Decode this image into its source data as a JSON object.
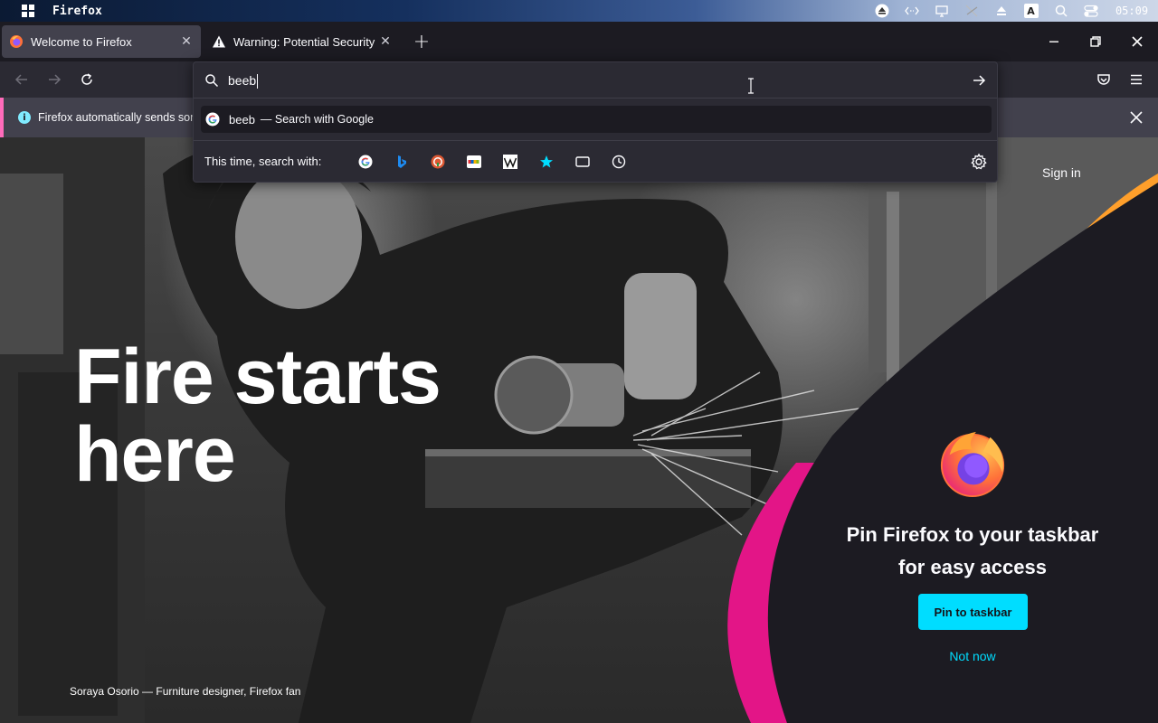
{
  "os_bar": {
    "app_name": "Firefox",
    "clock": "05:09",
    "tray_icons": [
      "eject-icon",
      "network-arrows-icon",
      "display-icon",
      "no-signal-icon",
      "eject-outline-icon",
      "keyboard-layout-icon",
      "search-icon",
      "toggle-icon"
    ],
    "keyboard_letter": "A"
  },
  "tabs": [
    {
      "title": "Welcome to Firefox",
      "icon": "firefox-icon",
      "active": true
    },
    {
      "title": "Warning: Potential Security Risk Ahead",
      "icon": "warning-icon",
      "active": false
    }
  ],
  "urlbar": {
    "value": "beeb",
    "suggestion_query": "beeb",
    "suggestion_action": "— Search with Google",
    "one_off_label": "This time, search with:",
    "engines": [
      "google-icon",
      "bing-icon",
      "duckduckgo-icon",
      "ebay-icon",
      "wikipedia-icon",
      "bookmarks-icon",
      "tabs-icon",
      "history-icon"
    ]
  },
  "notification": {
    "text": "Firefox automatically sends som"
  },
  "hero": {
    "headline_line1": "Fire starts",
    "headline_line2": "here",
    "caption": "Soraya Osorio — Furniture designer, Firefox fan",
    "sign_in": "Sign in"
  },
  "pin_card": {
    "title_line1": "Pin Firefox to your taskbar",
    "title_line2": "for easy access",
    "primary_button": "Pin to taskbar",
    "secondary_link": "Not now"
  },
  "colors": {
    "accent_cyan": "#00ddff",
    "accent_pink": "#ff6bba",
    "magenta_arc": "#e31587",
    "orange_arc": "#ff9f2b",
    "panel_bg": "#2b2a33",
    "card_bg": "#1c1b22"
  }
}
